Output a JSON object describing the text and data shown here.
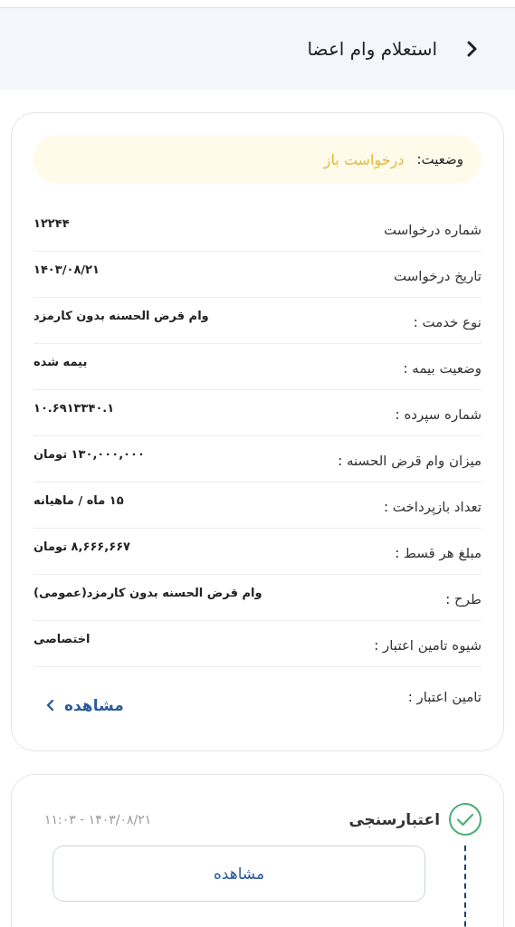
{
  "header": {
    "title": "استعلام وام اعضا"
  },
  "status": {
    "label": "وضعیت:",
    "value": "درخواست باز"
  },
  "details": [
    {
      "label": "شماره درخواست",
      "value": "۱۲۲۴۴"
    },
    {
      "label": "تاریخ درخواست",
      "value": "۱۴۰۳/۰۸/۲۱"
    },
    {
      "label": "نوع خدمت :",
      "value": "وام قرض الحسنه بدون کارمزد"
    },
    {
      "label": "وضعیت بیمه :",
      "value": "بیمه شده"
    },
    {
      "label": "شماره سپرده :",
      "value": "۱۰.۶۹۱۳۳۴۰.۱"
    },
    {
      "label": "میزان وام قرض الحسنه :",
      "value": "۱۳۰,۰۰۰,۰۰۰ تومان"
    },
    {
      "label": "تعداد بازپرداخت :",
      "value": "۱۵ ماه / ماهیانه"
    },
    {
      "label": "مبلغ هر قسط :",
      "value": "۸,۶۶۶,۶۶۷ تومان"
    },
    {
      "label": "طرح :",
      "value": "وام قرض الحسنه بدون کارمزد(عمومی)"
    },
    {
      "label": "شیوه تامین اعتبار :",
      "value": "اختصاصی"
    }
  ],
  "funding": {
    "label": "تامین اعتبار :",
    "link": "مشاهده"
  },
  "timeline": [
    {
      "title": "اعتبارسنجی",
      "time": "۱۴۰۳/۰۸/۲۱ - ۱۱:۰۳",
      "done": true,
      "button": "مشاهده"
    }
  ]
}
